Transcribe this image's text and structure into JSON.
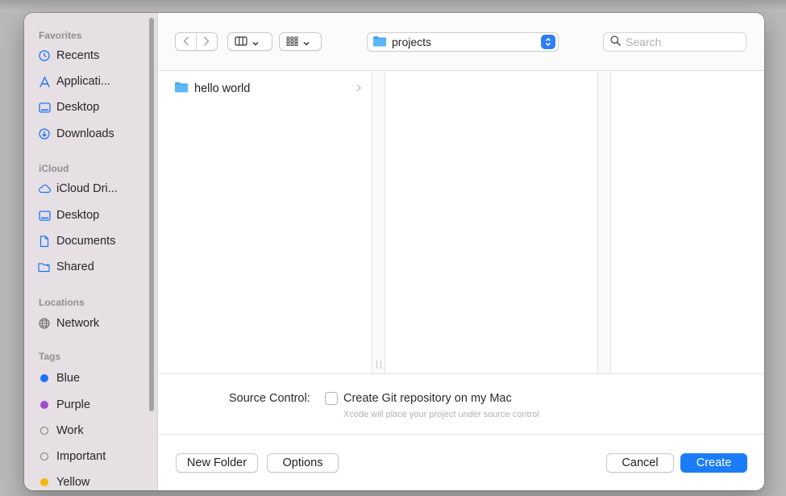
{
  "colors": {
    "accent": "#1b7cf7",
    "sidebar_bg": "#e6dfe3",
    "folder": "#46a6f1",
    "tag_blue": "#1f73f6",
    "tag_purple": "#a24cd0",
    "tag_yellow": "#f5b80b"
  },
  "toolbar": {
    "back_icon": "chevron-left-icon",
    "forward_icon": "chevron-right-icon",
    "view_columns_icon": "columns-view-icon",
    "view_group_icon": "grid-view-icon",
    "path_label": "projects",
    "search_placeholder": "Search",
    "search_value": ""
  },
  "sidebar": {
    "sections": [
      {
        "title": "Favorites",
        "items": [
          {
            "label": "Recents",
            "icon": "clock-icon"
          },
          {
            "label": "Applicati...",
            "icon": "applications-icon"
          },
          {
            "label": "Desktop",
            "icon": "desktop-icon"
          },
          {
            "label": "Downloads",
            "icon": "downloads-icon"
          }
        ]
      },
      {
        "title": "iCloud",
        "items": [
          {
            "label": "iCloud Dri...",
            "icon": "cloud-icon"
          },
          {
            "label": "Desktop",
            "icon": "desktop-icon"
          },
          {
            "label": "Documents",
            "icon": "document-icon"
          },
          {
            "label": "Shared",
            "icon": "shared-folder-icon"
          }
        ]
      },
      {
        "title": "Locations",
        "items": [
          {
            "label": "Network",
            "icon": "network-globe-icon"
          }
        ]
      },
      {
        "title": "Tags",
        "items": [
          {
            "label": "Blue",
            "icon": "tag-dot-icon"
          },
          {
            "label": "Purple",
            "icon": "tag-dot-icon"
          },
          {
            "label": "Work",
            "icon": "tag-ring-icon"
          },
          {
            "label": "Important",
            "icon": "tag-ring-icon"
          },
          {
            "label": "Yellow",
            "icon": "tag-dot-icon"
          }
        ]
      }
    ]
  },
  "browser": {
    "columns": [
      {
        "items": [
          {
            "label": "hello world",
            "icon": "folder-icon",
            "has_children": true
          }
        ]
      },
      {
        "items": []
      },
      {
        "items": []
      }
    ]
  },
  "source_control": {
    "label": "Source Control:",
    "checkbox_label": "Create Git repository on my Mac",
    "checked": false,
    "hint": "Xcode will place your project under source control"
  },
  "footer": {
    "new_folder": "New Folder",
    "options": "Options",
    "cancel": "Cancel",
    "create": "Create"
  }
}
